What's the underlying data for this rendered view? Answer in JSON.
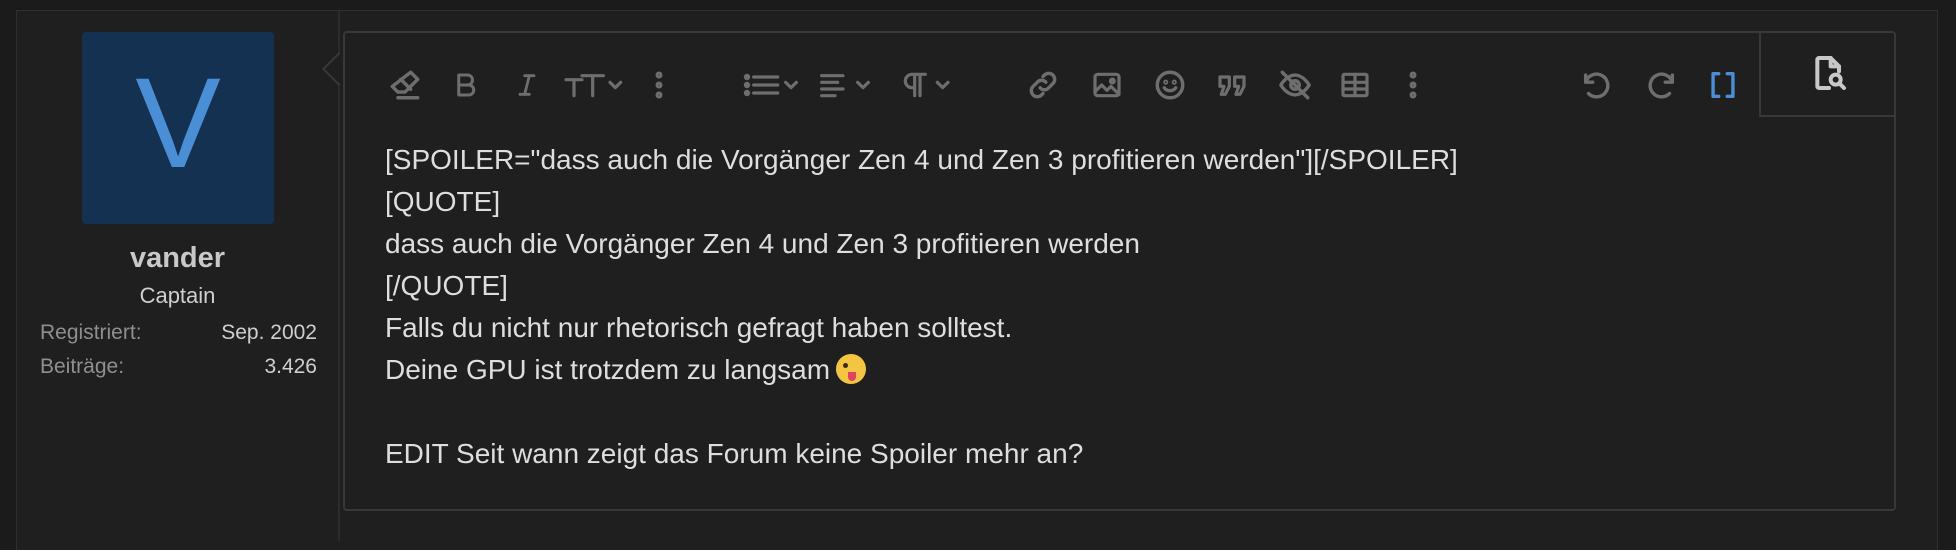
{
  "user": {
    "avatar_letter": "V",
    "name": "vander",
    "title": "Captain",
    "stats": [
      {
        "label": "Registriert:",
        "value": "Sep. 2002"
      },
      {
        "label": "Beiträge:",
        "value": "3.426"
      }
    ]
  },
  "toolbar": {
    "icons": [
      "eraser-icon",
      "bold-icon",
      "italic-icon",
      "text-size-icon",
      "more-vertical-icon",
      "list-icon",
      "align-icon",
      "paragraph-icon",
      "link-icon",
      "image-icon",
      "smiley-icon",
      "quote-icon",
      "spoiler-icon",
      "table-icon",
      "more-vertical-icon",
      "undo-icon",
      "redo-icon",
      "bbcode-toggle-icon",
      "preview-icon"
    ],
    "accent_color": "#4a8fd6"
  },
  "editor": {
    "lines": [
      "[SPOILER=\"dass auch die Vorgänger Zen 4 und Zen 3 profitieren werden\"][/SPOILER]",
      "[QUOTE]",
      "dass auch die Vorgänger Zen 4 und Zen 3 profitieren werden",
      "[/QUOTE]",
      "Falls du nicht nur rhetorisch gefragt haben solltest.",
      "Deine GPU ist trotzdem zu langsam",
      "",
      "EDIT Seit wann zeigt das Forum keine Spoiler mehr an?"
    ],
    "emoji": "winking-face-with-tongue-emoji"
  }
}
